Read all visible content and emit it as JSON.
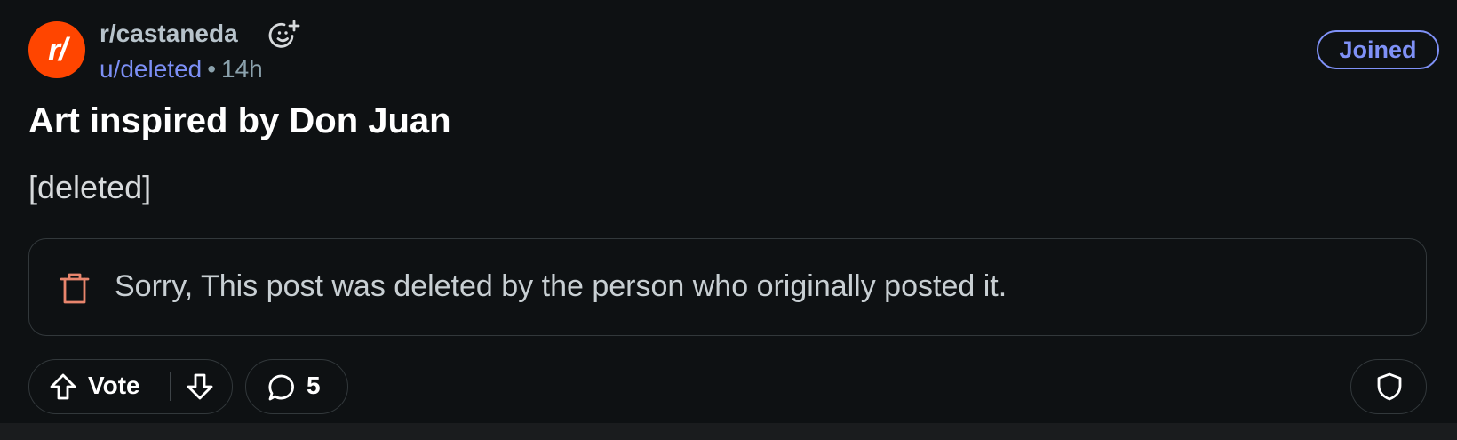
{
  "header": {
    "subreddit_avatar_text": "r/",
    "subreddit": "r/castaneda",
    "author": "u/deleted",
    "separator": "•",
    "age": "14h",
    "joined_label": "Joined"
  },
  "post": {
    "title": "Art inspired by Don Juan",
    "body": "[deleted]",
    "deleted_notice": "Sorry, This post was deleted by the person who originally posted it."
  },
  "actions": {
    "vote_label": "Vote",
    "comment_count": "5"
  },
  "icons": {
    "subreddit_emoji": "add-flair-emoji-icon",
    "trash": "trash-icon",
    "upvote": "upvote-arrow-icon",
    "downvote": "downvote-arrow-icon",
    "comment": "comment-bubble-icon",
    "mod": "shield-icon"
  },
  "colors": {
    "background": "#0e1113",
    "accent_link": "#7c8ff5",
    "joined_border": "#7f91f7",
    "avatar_bg": "#ff4500",
    "trash_icon": "#e8856d",
    "border": "#32383b"
  }
}
